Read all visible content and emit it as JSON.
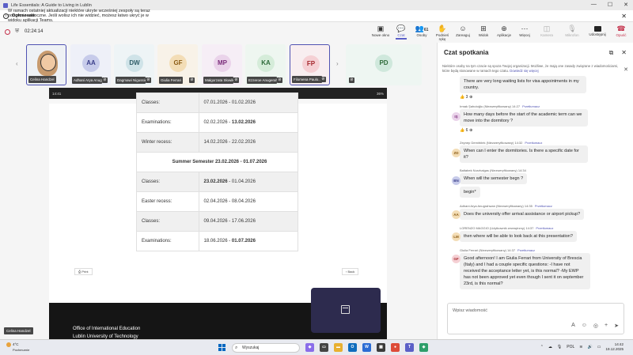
{
  "window": {
    "title": "Life Essentials: A Guide to Living in Lublin",
    "controls": [
      "—",
      "☐",
      "✕"
    ]
  },
  "notice": {
    "lead": "Ogłoszenie",
    "message": "W ramach ostatniej aktualizacji niektóre ukryte wcześniej zespoły są teraz ponownie widoczne. Jeśli wolisz ich nie widzieć, możesz łatwo ukryć je w widoku aplikacji Teams.",
    "close": "✕"
  },
  "meeting": {
    "timer": "02:24:14",
    "tools": [
      {
        "label": "Nowe okno",
        "icon": "▣"
      },
      {
        "label": "Czat",
        "icon": "💬"
      },
      {
        "label": "Osoby",
        "icon": "👥",
        "count": "61"
      },
      {
        "label": "Podnieś rękę",
        "icon": "✋"
      },
      {
        "label": "Zareaguj",
        "icon": "☺"
      },
      {
        "label": "Widok",
        "icon": "⊞"
      },
      {
        "label": "Aplikacje",
        "icon": "⊕"
      },
      {
        "label": "Więcej",
        "icon": "⋯"
      },
      {
        "label": "Kamera",
        "icon": "◫"
      },
      {
        "label": "Mikrofon",
        "icon": "🎙"
      },
      {
        "label": "Udostępnij",
        "icon": ""
      },
      {
        "label": "Opuść",
        "icon": "☎"
      }
    ]
  },
  "participants": [
    {
      "name": "Celina Handzel",
      "initials": "",
      "photo": true,
      "bg": "#e9e1d6"
    },
    {
      "name": "Adhani Arya Anugr...",
      "initials": "AA",
      "bg": "#c7cbea",
      "fg": "#3b3f8a"
    },
    {
      "name": "Dagmawi Nigussie ...",
      "initials": "DW",
      "bg": "#cfe3e8",
      "fg": "#2f5d68"
    },
    {
      "name": "Giulia Ferrari",
      "initials": "GF",
      "bg": "#f3ddb6",
      "fg": "#8a5a13"
    },
    {
      "name": "Małgorzata Słowik",
      "initials": "MP",
      "bg": "#ead3ea",
      "fg": "#7a2c7a"
    },
    {
      "name": "Ezzeroe Anugerah...",
      "initials": "KA",
      "bg": "#d5ecd9",
      "fg": "#2e6b3a"
    },
    {
      "name": "Filomena Paulo...",
      "initials": "FP",
      "bg": "#f5d0d4",
      "fg": "#a4262c"
    },
    {
      "name": "",
      "initials": "PD",
      "bg": "#cfe8dc",
      "fg": "#2e6b3a"
    }
  ],
  "shared_screen": {
    "status_time": "14:41",
    "status_right": "36%",
    "url": "a.bkm.polub.pl",
    "rows": [
      {
        "label": "Classes:",
        "value": "07.01.2026 - 01.02.2026"
      },
      {
        "label": "Examinations:",
        "value": "02.02.2026 - ",
        "value_bold": "13.02.2026"
      },
      {
        "label": "Winter recess:",
        "value": "14.02.2026 - 22.02.2026"
      },
      {
        "header": "Summer Semester   23.02.2026 - 01.07.2026"
      },
      {
        "label": "Classes:",
        "value_bold_first": "23.02.2026",
        "value": " - 01.04.2026"
      },
      {
        "label": "Easter recess:",
        "value": "02.04.2026 - 08.04.2026"
      },
      {
        "label": "Classes:",
        "value": "09.04.2026 - 17.06.2026"
      },
      {
        "label": "Examinations:",
        "value": "18.06.2026 - ",
        "value_bold": "01.07.2026"
      }
    ],
    "print_label": "Print",
    "back_label": "Back",
    "footer_line1": "Office of International Education",
    "footer_line2": "Lublin University of Technology",
    "self_label": "Celina Handzel"
  },
  "chat": {
    "title": "Czat spotkania",
    "notice": "Niektóre osoby na tym czacie są spoza Twojej organizacji. Możliwe, że mają one zasady związane z wiadomościami, które będą stosowane w ramach tego czatu.",
    "notice_link": "Dowiedz się więcej",
    "translate_label": "Przetłumacz",
    "messages": [
      {
        "author": "",
        "time": "",
        "text": "There are very long waiting lists for visa appointments in my country.",
        "initials": "",
        "reaction": "👍 3"
      },
      {
        "author": "Irmak Şahutoğlu (Niezweryfikowany)",
        "time": "14:27",
        "text": "How many days before the start of the academic term can we move into the dormitory ?",
        "initials": "IŞ",
        "bg": "#ead3ea",
        "fg": "#7a2c7a",
        "reaction": "👍 6"
      },
      {
        "author": "Zeynep Demirblek (Niezweryfikowany)",
        "time": "14:32",
        "text": "When can I enter the dormitories. Is there a specific date for it?",
        "initials": "ZD",
        "bg": "#f3ddb6",
        "fg": "#8a5a13"
      },
      {
        "author": "Baltabek Nurzhalgas (Niezweryfikowany)",
        "time": "14:34",
        "text": "When will the semester begn ?",
        "text2": "begin*",
        "initials": "BN",
        "bg": "#c7cbea",
        "fg": "#3b3f8a"
      },
      {
        "author": "Adhani Arya Anugrahwan (Niezweryfikowany)",
        "time": "14:35",
        "text": "Does the university offer arrival assistance or airport pickup?",
        "initials": "AA",
        "bg": "#f3ddb6",
        "fg": "#8a5a13"
      },
      {
        "author": "LORENZO MAGGIO (Użytkownik zewnętrzny)",
        "time": "14:37",
        "text": "then where will be able to look back at this presentation?",
        "initials": "LM",
        "bg": "#f3ddb6",
        "fg": "#8a5a13"
      },
      {
        "author": "Giulia Ferrari (Niezweryfikowany)",
        "time": "14:37",
        "text": "Good afternoon! I am Giulia Ferrari from University of Brescia (Italy) and I had a couple specific questions: -I have not received the acceptance letter yet, is this normal?  -My EWP has not been approved yet even though I sent it on september 23rd, is this normal?",
        "initials": "GF",
        "bg": "#f5d0d4",
        "fg": "#a4262c"
      }
    ],
    "compose_placeholder": "Wpisz wiadomość"
  },
  "taskbar": {
    "temperature": "4°C",
    "weather": "Pochmurnie",
    "search_placeholder": "Wyszukaj",
    "lang": "POL",
    "time": "14:42",
    "date": "19.12.2025"
  }
}
